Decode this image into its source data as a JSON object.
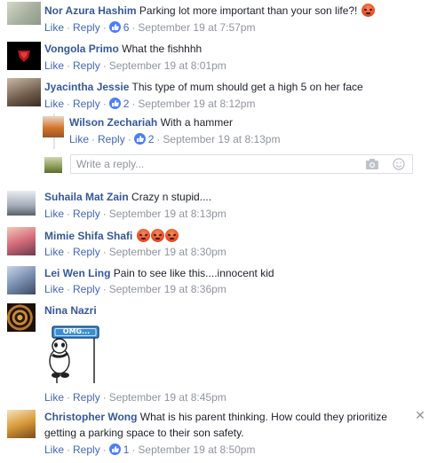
{
  "comments": [
    {
      "name": "Nor Azura Hashim",
      "text": "Parking lot more important than your son life?!",
      "like": "Like",
      "reply": "Reply",
      "count": "6",
      "time": "September 19 at 7:57pm"
    },
    {
      "name": "Vongola Primo",
      "text": "What the fishhhh",
      "like": "Like",
      "reply": "Reply",
      "time": "September 19 at 8:01pm"
    },
    {
      "name": "Jyacintha Jessie",
      "text": "This type of mum should get a high 5 on her face",
      "like": "Like",
      "reply": "Reply",
      "count": "2",
      "time": "September 19 at 8:12pm"
    },
    {
      "name": "Wilson Zechariah",
      "text": "With a hammer",
      "like": "Like",
      "reply": "Reply",
      "count": "2",
      "time": "September 19 at 8:13pm"
    },
    {
      "name": "Suhaila Mat Zain",
      "text": "Crazy n stupid....",
      "like": "Like",
      "reply": "Reply",
      "time": "September 19 at 8:13pm"
    },
    {
      "name": "Mimie Shifa Shafi",
      "text": "",
      "like": "Like",
      "reply": "Reply",
      "time": "September 19 at 8:30pm"
    },
    {
      "name": "Lei Wen Ling",
      "text": "Pain to see like this....innocent kid",
      "like": "Like",
      "reply": "Reply",
      "time": "September 19 at 8:36pm"
    },
    {
      "name": "Nina Nazri",
      "text": "",
      "like": "Like",
      "reply": "Reply",
      "time": "September 19 at 8:45pm",
      "sticker_text": "OMG..."
    },
    {
      "name": "Christopher Wong",
      "text": "What is his parent thinking. How could they prioritize",
      "text2": "getting a parking space to their son safety.",
      "like": "Like",
      "reply": "Reply",
      "count": "1",
      "time": "September 19 at 8:50pm"
    }
  ],
  "reply_box": {
    "placeholder": "Write a reply..."
  },
  "colors": {
    "name": "#365899",
    "link": "#4267b2",
    "meta": "#90949c",
    "like_badge": "#4a80f5",
    "angry": "#e2421d"
  },
  "icons": [
    "like-icon",
    "angry-reaction-icon",
    "camera-icon",
    "emoji-icon",
    "close-icon"
  ]
}
